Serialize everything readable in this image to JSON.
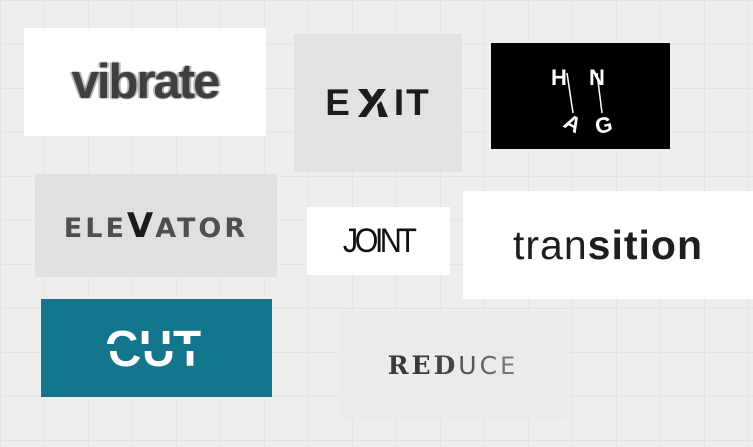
{
  "tiles": {
    "vibrate": "vibrate",
    "exit": {
      "e": "E",
      "x": "X",
      "it": "IT"
    },
    "hang": {
      "h": "H",
      "a": "A",
      "n": "N",
      "g": "G"
    },
    "elevator": {
      "pre": "ELE",
      "v": "V",
      "post": "ATOR"
    },
    "joint": "JOINT",
    "transition": {
      "light": "tran",
      "bold": "sition"
    },
    "cut": {
      "c": "C",
      "u": "U",
      "t": "T"
    },
    "reduce": {
      "r": "R",
      "e": "E",
      "d": "D",
      "u": "U",
      "c": "C",
      "e2": "E"
    }
  },
  "colors": {
    "background": "#eeeeee",
    "cut_tile": "#14768c",
    "hang_tile": "#000000"
  }
}
